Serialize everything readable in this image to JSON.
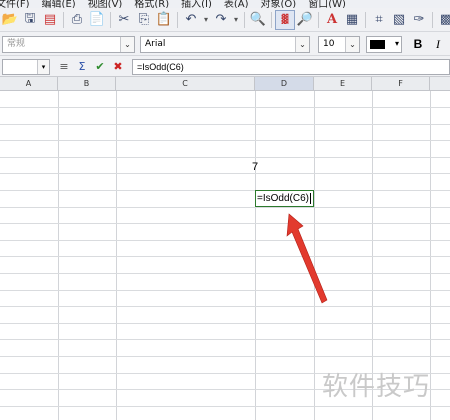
{
  "menu": [
    "文件(F)",
    "编辑(E)",
    "视图(V)",
    "格式(R)",
    "插入(I)",
    "表(A)",
    "对象(O)",
    "窗口(W)"
  ],
  "toolbar_icons": [
    "folder-open-icon",
    "save-icon",
    "export-pdf-icon",
    "print-icon",
    "print-preview-icon",
    "cut-icon",
    "copy-icon",
    "paste-icon",
    "undo-icon",
    "redo-icon",
    "find-icon",
    "chart-icon",
    "zoom-icon",
    "fontwork-icon",
    "table-icon",
    "grid-icon",
    "eraser-icon",
    "clear-format-icon",
    "styles-icon"
  ],
  "format": {
    "style_placeholder": "常规",
    "font_name": "Arial",
    "font_size": "10",
    "font_color": "#000000",
    "bold": "B",
    "italic": "I"
  },
  "formula_bar": {
    "name_box": "",
    "formula": "=IsOdd(C6)"
  },
  "columns": [
    "A",
    "B",
    "C",
    "D",
    "E",
    "F"
  ],
  "selected_column": "D",
  "cells": {
    "c6_value": "7",
    "d7_editing": "=IsOdd(C6)"
  },
  "annotation": {
    "arrow_color": "#e23a2e"
  },
  "watermark": "软件技巧"
}
